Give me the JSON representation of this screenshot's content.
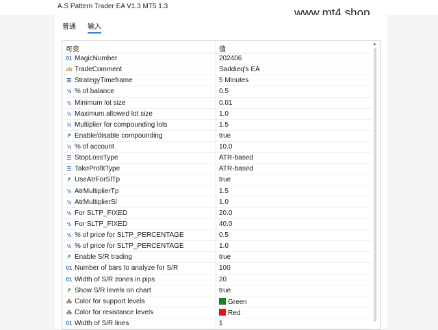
{
  "window": {
    "title": "A.S Pattern Trader EA V1.3 MT5 1.3"
  },
  "watermark": "www.mt4.shop",
  "tabs": [
    {
      "label": "普通",
      "active": false
    },
    {
      "label": "输入",
      "active": true
    }
  ],
  "table": {
    "headers": {
      "variable": "可变",
      "value": "值"
    },
    "rows": [
      {
        "icon": "int-icon",
        "name": "MagicNumber",
        "value": "202406"
      },
      {
        "icon": "string-icon",
        "name": "TradeComment",
        "value": "Saddieq's EA"
      },
      {
        "icon": "enum-icon",
        "name": "StrategyTimeframe",
        "value": "5 Minutes"
      },
      {
        "icon": "double-icon",
        "name": "% of balance",
        "value": "0.5"
      },
      {
        "icon": "double-icon",
        "name": "Minimum lot size",
        "value": "0.01"
      },
      {
        "icon": "double-icon",
        "name": "Maximum allowed lot size",
        "value": "1.0"
      },
      {
        "icon": "double-icon",
        "name": "Multiplier for compounding lots",
        "value": "1.5"
      },
      {
        "icon": "bool-icon",
        "name": "Enable/disable compounding",
        "value": "true"
      },
      {
        "icon": "double-icon",
        "name": "% of account",
        "value": "10.0"
      },
      {
        "icon": "enum-icon",
        "name": "StopLossType",
        "value": "ATR-based"
      },
      {
        "icon": "enum-icon",
        "name": "TakeProfitType",
        "value": "ATR-based"
      },
      {
        "icon": "bool-icon",
        "name": "UseAtrForSlTp",
        "value": "true"
      },
      {
        "icon": "double-icon",
        "name": "AtrMultiplierTp",
        "value": "1.5"
      },
      {
        "icon": "double-icon",
        "name": "AtrMultiplierSl",
        "value": "1.0"
      },
      {
        "icon": "double-icon",
        "name": "For SLTP_FIXED",
        "value": "20.0"
      },
      {
        "icon": "double-icon",
        "name": "For SLTP_FIXED",
        "value": "40.0"
      },
      {
        "icon": "double-icon",
        "name": "% of price for SLTP_PERCENTAGE",
        "value": "0.5"
      },
      {
        "icon": "double-icon",
        "name": "% of price for SLTP_PERCENTAGE",
        "value": "1.0"
      },
      {
        "icon": "bool-icon",
        "name": "Enable S/R trading",
        "value": "true"
      },
      {
        "icon": "int-icon",
        "name": "Number of bars to analyze for S/R",
        "value": "100"
      },
      {
        "icon": "int-icon",
        "name": "Width of S/R zones in pips",
        "value": "20"
      },
      {
        "icon": "bool-icon",
        "name": "Show S/R levels on chart",
        "value": "true"
      },
      {
        "icon": "color-icon",
        "name": "Color for support levels",
        "value": "Green",
        "swatch": "#0a8a1a"
      },
      {
        "icon": "color-icon",
        "name": "Color for resistance levels",
        "value": "Red",
        "swatch": "#ee1111"
      },
      {
        "icon": "int-icon",
        "name": "Width of S/R lines",
        "value": "1"
      }
    ]
  },
  "icon_glyphs": {
    "int-icon": "01",
    "string-icon": "ab",
    "enum-icon": "☰",
    "double-icon": "½",
    "bool-icon": "↱",
    "color-icon": "⁂"
  }
}
